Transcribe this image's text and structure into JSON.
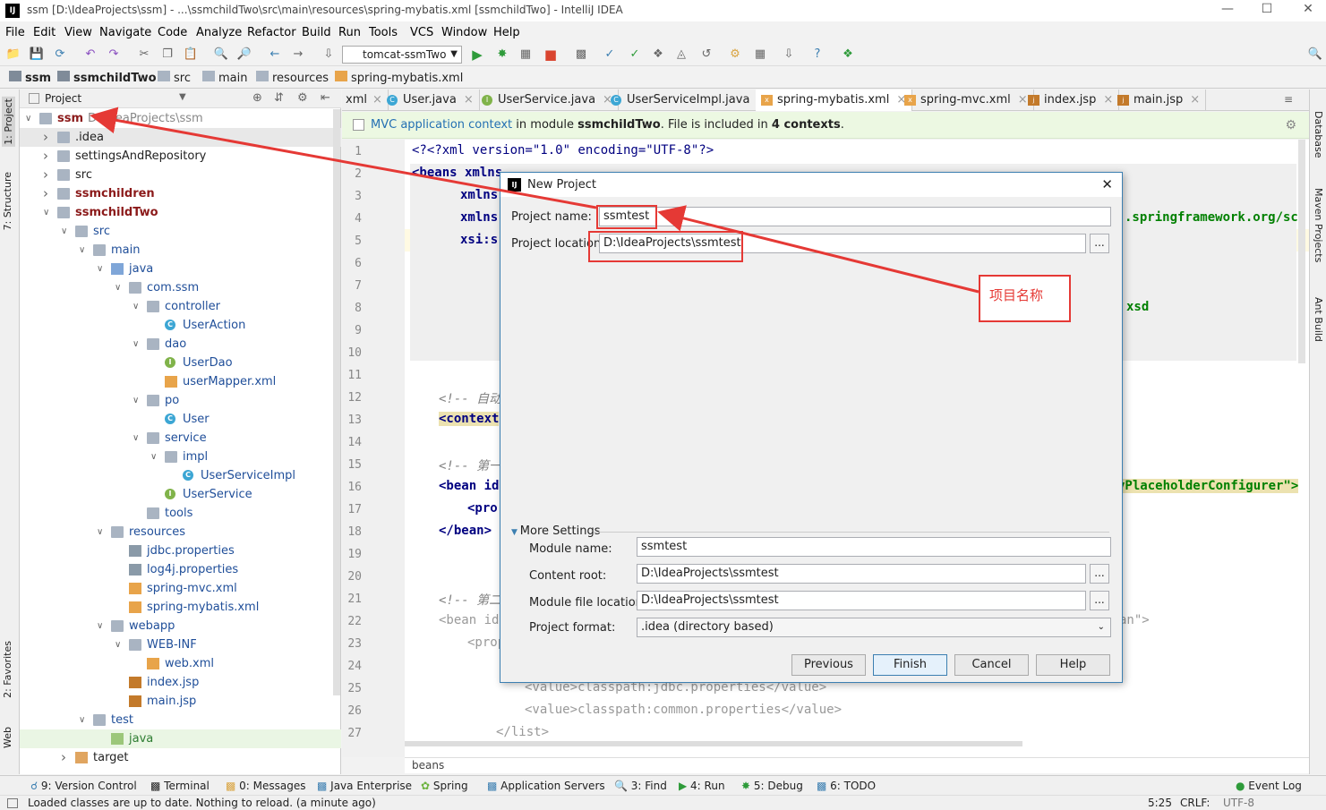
{
  "window": {
    "title": "ssm [D:\\IdeaProjects\\ssm] - ...\\ssmchildTwo\\src\\main\\resources\\spring-mybatis.xml [ssmchildTwo] - IntelliJ IDEA",
    "logo": "IJ"
  },
  "menu": [
    "File",
    "Edit",
    "View",
    "Navigate",
    "Code",
    "Analyze",
    "Refactor",
    "Build",
    "Run",
    "Tools",
    "VCS",
    "Window",
    "Help"
  ],
  "toolbar": {
    "run_config": "tomcat-ssmTwo"
  },
  "breadcrumb": [
    "ssm",
    "ssmchildTwo",
    "src",
    "main",
    "resources",
    "spring-mybatis.xml"
  ],
  "left_tool_tabs": [
    "1: Project",
    "7: Structure",
    "2: Favorites",
    "Web"
  ],
  "right_tool_tabs": [
    "Database",
    "Maven Projects",
    "Ant Build"
  ],
  "project": {
    "header": "Project",
    "tree": [
      {
        "label": "ssm",
        "extra": "D:\\IdeaProjects\\ssm",
        "depth": 0,
        "arrow": "down",
        "icon": "module",
        "bold": true
      },
      {
        "label": ".idea",
        "depth": 1,
        "arrow": "right",
        "icon": "folder"
      },
      {
        "label": "settingsAndRepository",
        "depth": 1,
        "arrow": "right",
        "icon": "folder"
      },
      {
        "label": "src",
        "depth": 1,
        "arrow": "right",
        "icon": "folder"
      },
      {
        "label": "ssmchildren",
        "depth": 1,
        "arrow": "right",
        "icon": "module",
        "bold": true
      },
      {
        "label": "ssmchildTwo",
        "depth": 1,
        "arrow": "down",
        "icon": "module",
        "bold": true
      },
      {
        "label": "src",
        "depth": 2,
        "arrow": "down",
        "icon": "folder"
      },
      {
        "label": "main",
        "depth": 3,
        "arrow": "down",
        "icon": "folder"
      },
      {
        "label": "java",
        "depth": 4,
        "arrow": "down",
        "icon": "srcfolder"
      },
      {
        "label": "com.ssm",
        "depth": 5,
        "arrow": "down",
        "icon": "folder"
      },
      {
        "label": "controller",
        "depth": 6,
        "arrow": "down",
        "icon": "folder"
      },
      {
        "label": "UserAction",
        "depth": 7,
        "arrow": "",
        "icon": "class"
      },
      {
        "label": "dao",
        "depth": 6,
        "arrow": "down",
        "icon": "folder"
      },
      {
        "label": "UserDao",
        "depth": 7,
        "arrow": "",
        "icon": "interface"
      },
      {
        "label": "userMapper.xml",
        "depth": 7,
        "arrow": "",
        "icon": "xml"
      },
      {
        "label": "po",
        "depth": 6,
        "arrow": "down",
        "icon": "folder"
      },
      {
        "label": "User",
        "depth": 7,
        "arrow": "",
        "icon": "class"
      },
      {
        "label": "service",
        "depth": 6,
        "arrow": "down",
        "icon": "folder"
      },
      {
        "label": "impl",
        "depth": 7,
        "arrow": "down",
        "icon": "folder"
      },
      {
        "label": "UserServiceImpl",
        "depth": 8,
        "arrow": "",
        "icon": "class"
      },
      {
        "label": "UserService",
        "depth": 7,
        "arrow": "",
        "icon": "interface"
      },
      {
        "label": "tools",
        "depth": 6,
        "arrow": "",
        "icon": "folder"
      },
      {
        "label": "resources",
        "depth": 4,
        "arrow": "down",
        "icon": "resfolder"
      },
      {
        "label": "jdbc.properties",
        "depth": 5,
        "arrow": "",
        "icon": "prop"
      },
      {
        "label": "log4j.properties",
        "depth": 5,
        "arrow": "",
        "icon": "prop"
      },
      {
        "label": "spring-mvc.xml",
        "depth": 5,
        "arrow": "",
        "icon": "xml"
      },
      {
        "label": "spring-mybatis.xml",
        "depth": 5,
        "arrow": "",
        "icon": "xml"
      },
      {
        "label": "webapp",
        "depth": 4,
        "arrow": "down",
        "icon": "folder"
      },
      {
        "label": "WEB-INF",
        "depth": 5,
        "arrow": "down",
        "icon": "folder"
      },
      {
        "label": "web.xml",
        "depth": 6,
        "arrow": "",
        "icon": "xml"
      },
      {
        "label": "index.jsp",
        "depth": 5,
        "arrow": "",
        "icon": "jsp"
      },
      {
        "label": "main.jsp",
        "depth": 5,
        "arrow": "",
        "icon": "jsp"
      },
      {
        "label": "test",
        "depth": 3,
        "arrow": "down",
        "icon": "folder"
      },
      {
        "label": "java",
        "depth": 4,
        "arrow": "",
        "icon": "testfolder"
      },
      {
        "label": "target",
        "depth": 2,
        "arrow": "right",
        "icon": "orangefolder"
      }
    ]
  },
  "editor_tabs": [
    {
      "label": "xml",
      "icon": ""
    },
    {
      "label": "User.java",
      "icon": "C"
    },
    {
      "label": "UserService.java",
      "icon": "I"
    },
    {
      "label": "UserServiceImpl.java",
      "icon": "C"
    },
    {
      "label": "spring-mybatis.xml",
      "icon": "x",
      "active": true
    },
    {
      "label": "spring-mvc.xml",
      "icon": "x"
    },
    {
      "label": "index.jsp",
      "icon": "j"
    },
    {
      "label": "main.jsp",
      "icon": "j"
    }
  ],
  "notice": {
    "link": "MVC application context",
    "text1": " in module ",
    "module": "ssmchildTwo",
    "text2": ". File is included in ",
    "count": "4 contexts",
    "text3": "."
  },
  "code_lines": [
    "1",
    "2",
    "3",
    "4",
    "5",
    "6",
    "7",
    "8",
    "9",
    "10",
    "11",
    "12",
    "13",
    "14",
    "15",
    "16",
    "17",
    "18",
    "19",
    "20",
    "21",
    "22",
    "23",
    "24",
    "25",
    "26",
    "27"
  ],
  "code": {
    "l1": "<?xml version=\"1.0\" encoding=\"UTF-8\"?>",
    "l2": "<beans xmlns",
    "l3": "xmlns",
    "l4": "xmlns",
    "l4r": ".springframework.org/sch",
    "l5": "xsi:s",
    "l8r": "xsd",
    "l12": "<!-- 自动",
    "l13": "<context",
    "l15": "<!-- 第一",
    "l16": "<bean id",
    "l16r": "yPlaceholderConfigurer\">",
    "l17": "<pro",
    "l18": "</bean>",
    "l21": "<!-- 第二",
    "l22": "<bean id",
    "l22r": "an\">",
    "l23": "<prop",
    "l25": "<value>classpath:jdbc.properties</value>",
    "l26": "<value>classpath:common.properties</value>",
    "l27": "</list>"
  },
  "editor_status": "beans",
  "bottom_tools": [
    "9: Version Control",
    "Terminal",
    "0: Messages",
    "Java Enterprise",
    "Spring",
    "Application Servers",
    "3: Find",
    "4: Run",
    "5: Debug",
    "6: TODO",
    "Event Log"
  ],
  "status": {
    "message": "Loaded classes are up to date. Nothing to reload. (a minute ago)",
    "position": "5:25",
    "line_sep": "CRLF:",
    "encoding": "UTF-8"
  },
  "dialog": {
    "title": "New Project",
    "project_name_label": "Project name:",
    "project_name": "ssmtest",
    "project_location_label": "Project location:",
    "project_location": "D:\\IdeaProjects\\ssmtest",
    "more_settings": "More Settings",
    "module_name_label": "Module name:",
    "module_name": "ssmtest",
    "content_root_label": "Content root:",
    "content_root": "D:\\IdeaProjects\\ssmtest",
    "module_file_label": "Module file location:",
    "module_file": "D:\\IdeaProjects\\ssmtest",
    "project_format_label": "Project format:",
    "project_format": ".idea (directory based)",
    "buttons": {
      "previous": "Previous",
      "finish": "Finish",
      "cancel": "Cancel",
      "help": "Help"
    },
    "browse": "..."
  },
  "annotation": {
    "text": "项目名称",
    "color": "#e53935"
  }
}
